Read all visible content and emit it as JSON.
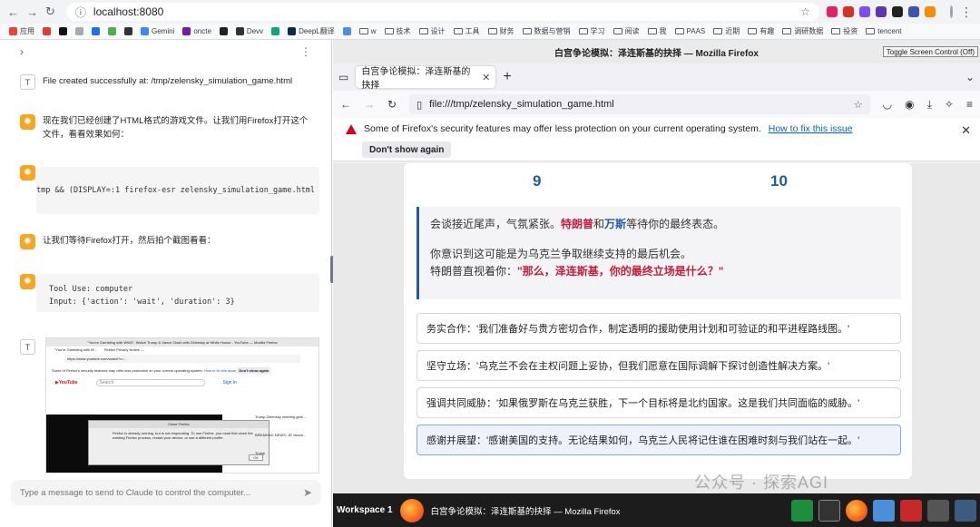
{
  "browser": {
    "url": "localhost:8080",
    "bookmarks": [
      "应用",
      "Gemini",
      "oncte",
      "Devv",
      "DeepL翻译",
      "w",
      "技术",
      "设计",
      "工具",
      "财务",
      "数据与营销",
      "学习",
      "阅读",
      "我",
      "PAAS",
      "近期",
      "有趣",
      "调研数据",
      "投资",
      "tencent"
    ]
  },
  "chat": {
    "messages": [
      {
        "role": "T",
        "text": "File created successfully at: /tmp/zelensky_simulation_game.html"
      },
      {
        "role": "assistant",
        "text": "现在我们已经创建了HTML格式的游戏文件。让我们用Firefox打开这个文件，看看效果如何："
      },
      {
        "role": "code",
        "text": "tmp && (DISPLAY=:1 firefox-esr zelensky_simulation_game.html &)'}"
      },
      {
        "role": "assistant",
        "text": "让我们等待Firefox打开，然后拍个截图看看："
      },
      {
        "role": "tool",
        "text": "Tool Use: computer\nInput: {'action': 'wait', 'duration': 3}"
      },
      {
        "role": "T",
        "text": ""
      }
    ],
    "thumbnail": {
      "window_title": "\"You're Gambling with WW3\": Watch Trump & Vance Clash with Zelensky at White House - YouTube — Mozilla Firefox",
      "tab1": "\"You're Gambling with W...",
      "tab2": "Firefox Privacy Notice —",
      "url": "https://www.youtube.com/watch?v=...",
      "warning": "Some of Firefox's security features may offer less protection on your current operating system.",
      "warning_link": "How to fix this issue",
      "dont_show": "Don't show again",
      "search": "Search",
      "dialog_title": "Close Firefox",
      "dialog_text": "Firefox is already running, but is not responding. To use Firefox, you must first close the existing Firefox process, restart your device, or use a different profile.",
      "dialog_ok": "OK",
      "sign_in": "Sign in",
      "side_items": [
        "Trump-Zelensky meeting gets...",
        "BREAKING NEWS: JD Vance...",
        "Trump"
      ]
    },
    "input_placeholder": "Type a message to send to Claude to control the computer..."
  },
  "firefox": {
    "window_title": "白宫争论模拟：泽连斯基的抉择 — Mozilla Firefox",
    "toggle_button": "Toggle Screen Control (Off)",
    "tab_title": "白宫争论模拟：泽连斯基的抉择",
    "url": "file:///tmp/zelensky_simulation_game.html",
    "warning": "Some of Firefox's security features may offer less protection on your current operating system.",
    "warning_link": "How to fix this issue",
    "dont_show": "Don't show again"
  },
  "game": {
    "stat_left": "9",
    "stat_right": "10",
    "story": {
      "p1_a": "会谈接近尾声，气氛紧张。",
      "trump": "特朗普",
      "and": "和",
      "vance": "万斯",
      "p1_b": "等待你的最终表态。",
      "p2": "你意识到这可能是为乌克兰争取继续支持的最后机会。",
      "p3_a": "特朗普直视着你：",
      "p3_quote": "\"那么，泽连斯基，你的最终立场是什么？\""
    },
    "choices": [
      "务实合作：'我们准备好与贵方密切合作，制定透明的援助使用计划和可验证的和平进程路线图。'",
      "坚守立场：'乌克兰不会在主权问题上妥协，但我们愿意在国际调解下探讨创造性解决方案。'",
      "强调共同威胁：'如果俄罗斯在乌克兰获胜，下一个目标将是北约国家。这是我们共同面临的威胁。'",
      "感谢并展望：'感谢美国的支持。无论结果如何，乌克兰人民将记住谁在困难时刻与我们站在一起。'"
    ]
  },
  "taskbar": {
    "workspace": "Workspace 1",
    "window_title": "白宫争论模拟：泽连斯基的抉择 — Mozilla Firefox"
  },
  "watermark": "公众号 · 探索AGI",
  "colors": {
    "accent_blue": "#1f5aa6",
    "accent_red": "#c41e3a",
    "warn_red": "#d70022"
  }
}
